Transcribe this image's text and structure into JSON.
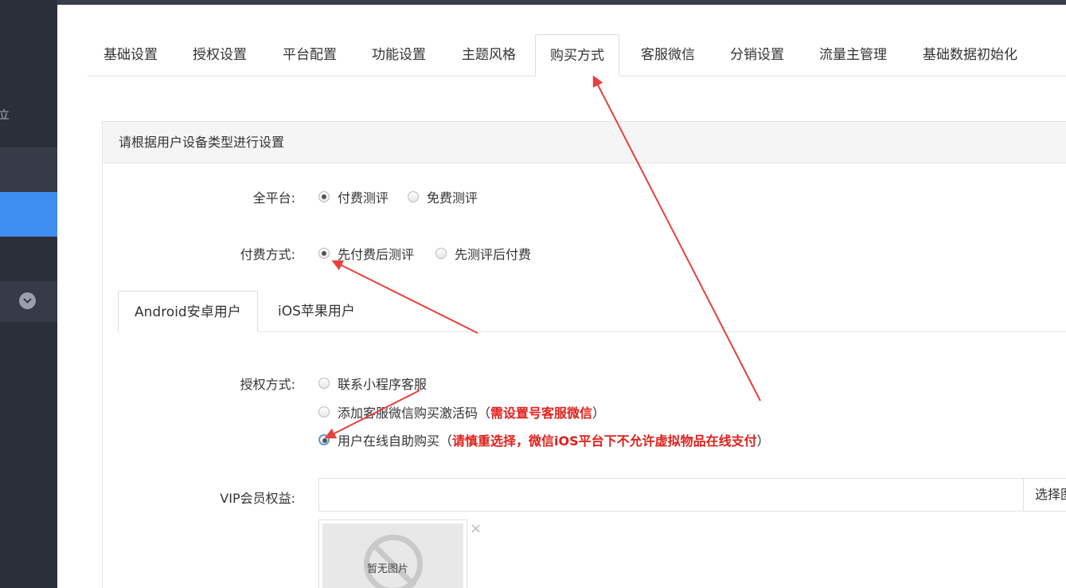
{
  "sidebar": {
    "frag_text": "立",
    "toggle_icon": "chevron-down-icon"
  },
  "tabs": [
    {
      "label": "基础设置"
    },
    {
      "label": "授权设置"
    },
    {
      "label": "平台配置"
    },
    {
      "label": "功能设置"
    },
    {
      "label": "主题风格"
    },
    {
      "label": "购买方式"
    },
    {
      "label": "客服微信"
    },
    {
      "label": "分销设置"
    },
    {
      "label": "流量主管理"
    },
    {
      "label": "基础数据初始化"
    }
  ],
  "active_tab": "购买方式",
  "panel": {
    "heading": "请根据用户设备类型进行设置"
  },
  "form": {
    "platform": {
      "label": "全平台:",
      "options": [
        "付费测评",
        "免费测评"
      ],
      "selected": "付费测评"
    },
    "pay_mode": {
      "label": "付费方式:",
      "options": [
        "先付费后测评",
        "先测评后付费"
      ],
      "selected": "先付费后测评"
    },
    "subtabs": [
      "Android安卓用户",
      "iOS苹果用户"
    ],
    "active_subtab": "Android安卓用户",
    "auth": {
      "label": "授权方式:",
      "opt1": "联系小程序客服",
      "opt2_text": "添加客服微信购买激活码（",
      "opt2_warn": "需设置号客服微信",
      "opt2_end": "）",
      "opt3_text": "用户在线自助购买（",
      "opt3_warn": "请慎重选择，微信iOS平台下不允许虚拟物品在线支付",
      "opt3_end": "）",
      "selected": "用户在线自助购买"
    },
    "vip": {
      "label": "VIP会员权益:",
      "input_value": "",
      "button_label": "选择图片",
      "thumb_text": "暂无图片",
      "remove_icon": "×"
    }
  },
  "colors": {
    "sidebar_bg": "#2b2f3a",
    "sidebar_active": "#3d8ef0",
    "warn_text": "#e0201b",
    "annotation_arrow": "#e8403b"
  }
}
